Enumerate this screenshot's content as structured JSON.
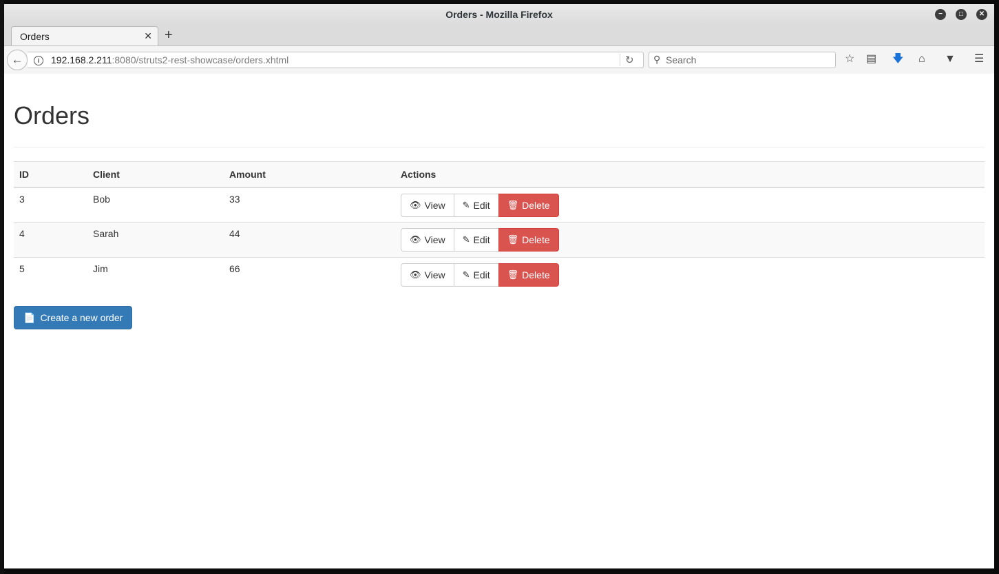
{
  "window": {
    "title": "Orders - Mozilla Firefox",
    "controls": {
      "minimize": "−",
      "maximize": "□",
      "close": "✕"
    }
  },
  "tabs": [
    {
      "label": "Orders",
      "close": "✕"
    }
  ],
  "new_tab_label": "+",
  "navbar": {
    "url_host": "192.168.2.211",
    "url_rest": ":8080/struts2-rest-showcase/orders.xhtml",
    "search_placeholder": "Search"
  },
  "page": {
    "title": "Orders",
    "table": {
      "headers": [
        "ID",
        "Client",
        "Amount",
        "Actions"
      ],
      "rows": [
        {
          "id": "3",
          "client": "Bob",
          "amount": "33"
        },
        {
          "id": "4",
          "client": "Sarah",
          "amount": "44"
        },
        {
          "id": "5",
          "client": "Jim",
          "amount": "66"
        }
      ],
      "actions": {
        "view": "View",
        "edit": "Edit",
        "delete": "Delete"
      }
    },
    "create_label": "Create a new order"
  },
  "colors": {
    "danger": "#d9534f",
    "primary": "#337ab7",
    "download_icon": "#1a73d8"
  }
}
